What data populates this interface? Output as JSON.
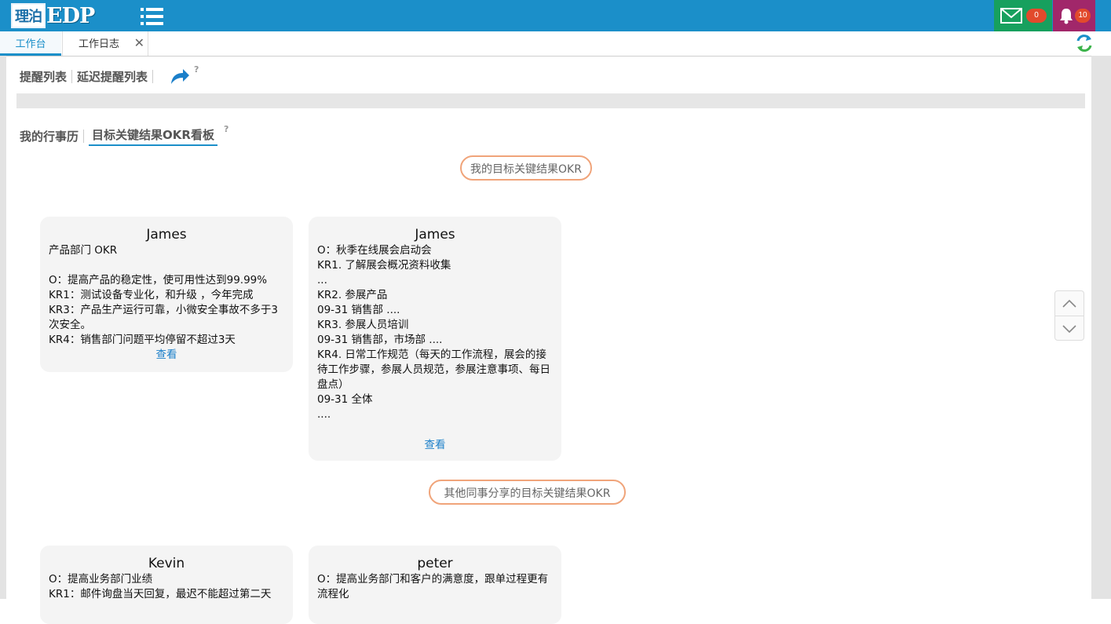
{
  "header": {
    "logo_cn": "理泊",
    "logo_en": "EDP",
    "mail_count": "0",
    "notice_count": "10"
  },
  "tabs": [
    {
      "label": "工作台"
    },
    {
      "label": "工作日志"
    }
  ],
  "reminders": {
    "list_label": "提醒列表",
    "delayed_label": "延迟提醒列表",
    "help": "?"
  },
  "board_tabs": {
    "calendar_label": "我的行事历",
    "okr_label": "目标关键结果OKR看板",
    "help": "?"
  },
  "my_okr": {
    "title": "我的目标关键结果OKR",
    "cards": [
      {
        "name": "James",
        "lines": [
          "产品部门 OKR",
          " ",
          "O：提高产品的稳定性，使可用性达到99.99%",
          "KR1：测试设备专业化，和升级 ，今年完成",
          "KR3：产品生产运行可靠，小微安全事故不多于3次安全。",
          "KR4：销售部门问题平均停留不超过3天"
        ],
        "view_label": "查看"
      },
      {
        "name": "James",
        "lines": [
          "O：秋季在线展会启动会",
          "KR1. 了解展会概况资料收集",
          "...",
          "KR2. 参展产品",
          "09-31 销售部 ....",
          "KR3. 参展人员培训",
          "09-31 销售部，市场部 ....",
          "KR4. 日常工作规范（每天的工作流程，展会的接待工作步骤，参展人员规范，参展注意事项、每日盘点）",
          "09-31 全体",
          "...."
        ],
        "view_label": "查看"
      }
    ]
  },
  "shared_okr": {
    "title": "其他同事分享的目标关键结果OKR",
    "cards": [
      {
        "name": "Kevin",
        "lines": [
          "O：提高业务部门业绩",
          "KR1：邮件询盘当天回复，最迟不能超过第二天"
        ]
      },
      {
        "name": "peter",
        "lines": [
          "O：提高业务部门和客户的满意度，跟单过程更有流程化"
        ]
      }
    ]
  },
  "colors": {
    "header_bg": "#1b8fc9",
    "mail_bg": "#17a05e",
    "bell_bg": "#a1276a",
    "badge": "#e24a2c",
    "pill_border": "#f0a47a"
  }
}
